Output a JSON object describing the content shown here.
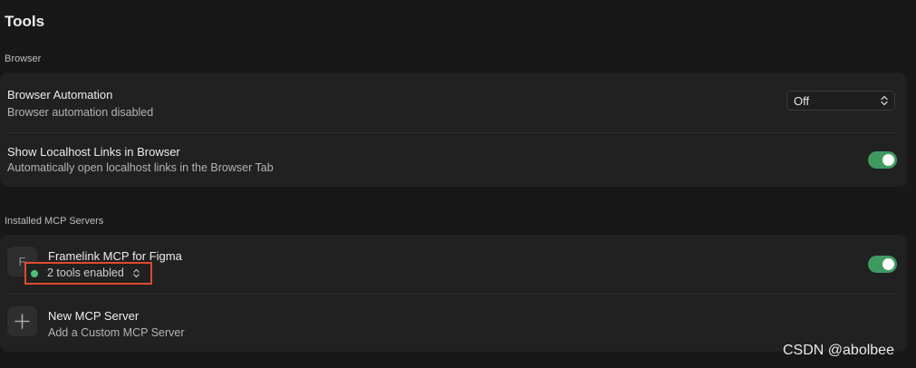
{
  "page": {
    "title": "Tools"
  },
  "browser_section": {
    "label": "Browser",
    "browser_automation": {
      "title": "Browser Automation",
      "subtitle": "Browser automation disabled",
      "select_value": "Off"
    },
    "localhost_links": {
      "title": "Show Localhost Links in Browser",
      "subtitle": "Automatically open localhost links in the Browser Tab",
      "enabled": true
    }
  },
  "mcp_section": {
    "label": "Installed MCP Servers",
    "servers": [
      {
        "avatar_letter": "F",
        "name": "Framelink MCP for Figma",
        "status": "2 tools enabled",
        "enabled": true
      }
    ],
    "new_server": {
      "title": "New MCP Server",
      "subtitle": "Add a Custom MCP Server"
    }
  },
  "colors": {
    "accent_green": "#3f9a62",
    "status_dot": "#4fbf73",
    "highlight_border": "#e0492f"
  },
  "watermark": "CSDN @abolbee"
}
